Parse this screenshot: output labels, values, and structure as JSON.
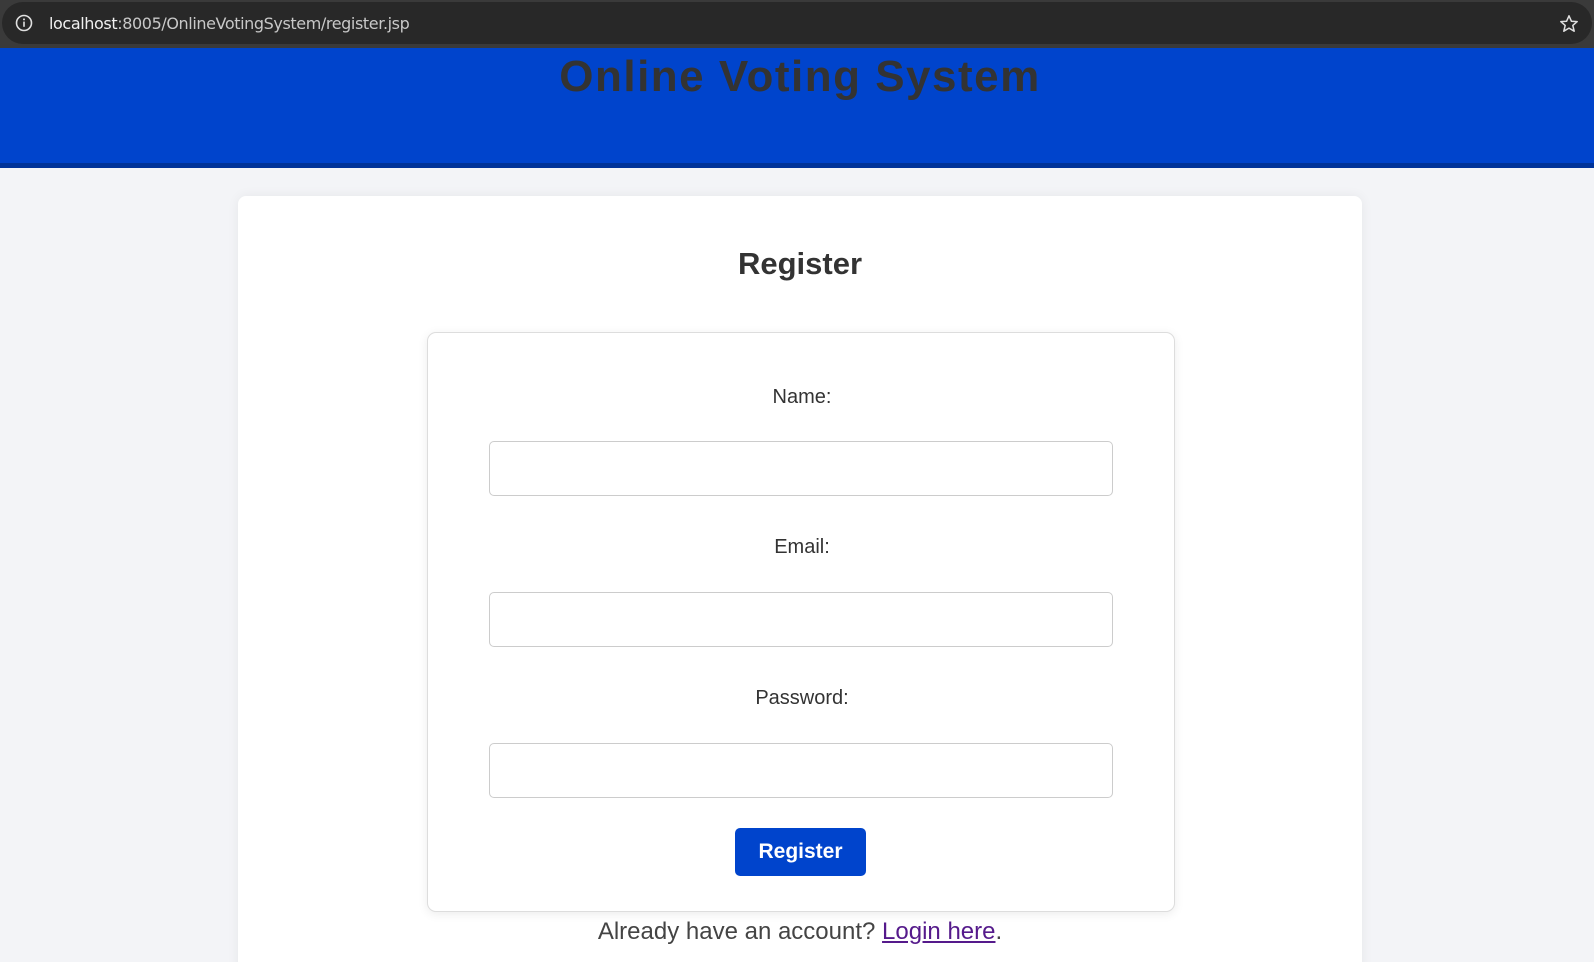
{
  "browser": {
    "url_host": "localhost",
    "url_rest": ":8005/OnlineVotingSystem/register.jsp",
    "info_icon": "info-icon",
    "bookmark_icon": "star-icon"
  },
  "header": {
    "title": "Online Voting System",
    "background_color": "#0044cc"
  },
  "register": {
    "title": "Register",
    "fields": [
      {
        "label": "Name:",
        "value": "",
        "placeholder": ""
      },
      {
        "label": "Email:",
        "value": "",
        "placeholder": ""
      },
      {
        "label": "Password:",
        "value": "",
        "placeholder": ""
      }
    ],
    "submit_label": "Register",
    "login_prompt": "Already have an account?",
    "login_link": "Login here",
    "login_suffix": "."
  }
}
